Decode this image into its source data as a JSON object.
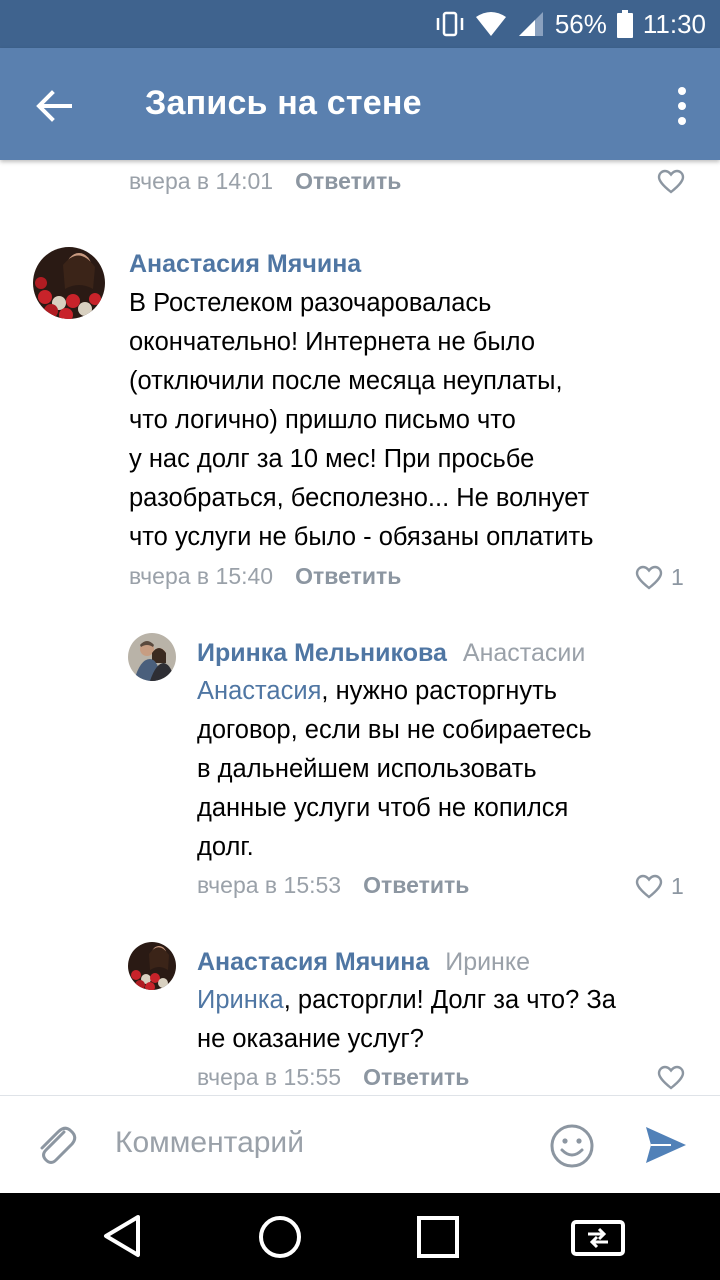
{
  "status_bar": {
    "battery": "56%",
    "time": "11:30"
  },
  "app_bar": {
    "title": "Запись на стене"
  },
  "reply_label": "Ответить",
  "comments": [
    {
      "time": "вчера в 14:01",
      "likes": ""
    },
    {
      "author": "Анастасия Мячина",
      "text_lines": [
        "В Ростелеком разочаровалась",
        "окончательно! Интернета не было",
        "(отключили после месяца неуплаты,",
        "что логично) пришло письмо что",
        "у нас долг за 10 мес! При просьбе",
        "разобраться, бесполезно... Не волнует",
        "что услуги не было - обязаны оплатить"
      ],
      "time": "вчера в 15:40",
      "likes": "1"
    },
    {
      "author": "Иринка Мельникова",
      "reply_to": "Анастасии",
      "mention": "Анастасия",
      "first_rest": ", нужно расторгнуть",
      "text_lines": [
        "договор, если вы не собираетесь",
        "в дальнейшем использовать",
        "данные услуги чтоб не копился",
        "долг."
      ],
      "time": "вчера в 15:53",
      "likes": "1"
    },
    {
      "author": "Анастасия Мячина",
      "reply_to": "Иринке",
      "mention": "Иринка",
      "first_rest": ", расторгли! Долг за что? За",
      "text_lines": [
        "не оказание услуг?"
      ],
      "time": "вчера в 15:55",
      "likes": ""
    }
  ],
  "composer": {
    "placeholder": "Комментарий"
  }
}
